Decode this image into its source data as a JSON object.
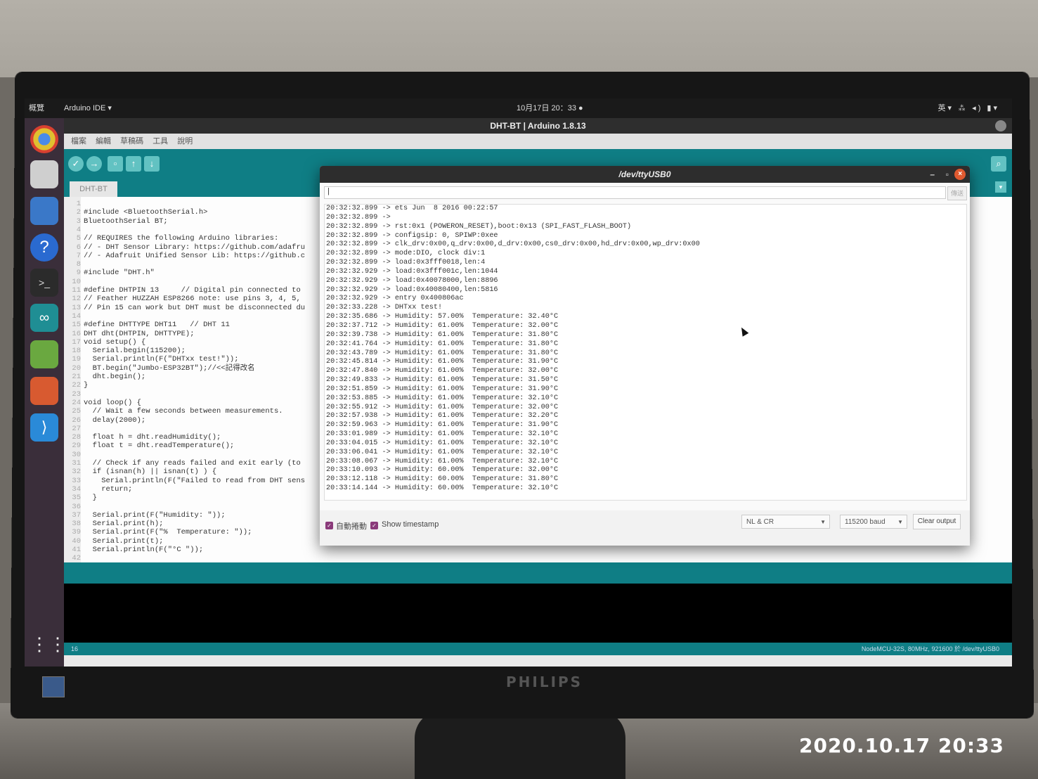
{
  "topbar": {
    "activities": "概覽",
    "app_menu": "Arduino IDE ▾",
    "clock": "10月17日 20：33 ●",
    "status": "英▾ ⁂ ◂) ▮▾"
  },
  "window": {
    "title": "DHT-BT | Arduino 1.8.13"
  },
  "menus": [
    "檔案",
    "編輯",
    "草稿碼",
    "工具",
    "說明"
  ],
  "tab": {
    "label": "DHT-BT"
  },
  "code": [
    {
      "n": "1",
      "t": ""
    },
    {
      "n": "2",
      "t": "#include <BluetoothSerial.h>"
    },
    {
      "n": "3",
      "t": "BluetoothSerial BT;"
    },
    {
      "n": "4",
      "t": ""
    },
    {
      "n": "5",
      "t": "// REQUIRES the following Arduino libraries:"
    },
    {
      "n": "6",
      "t": "// - DHT Sensor Library: https://github.com/adafru"
    },
    {
      "n": "7",
      "t": "// - Adafruit Unified Sensor Lib: https://github.c"
    },
    {
      "n": "8",
      "t": ""
    },
    {
      "n": "9",
      "t": "#include \"DHT.h\""
    },
    {
      "n": "10",
      "t": ""
    },
    {
      "n": "11",
      "t": "#define DHTPIN 13     // Digital pin connected to"
    },
    {
      "n": "12",
      "t": "// Feather HUZZAH ESP8266 note: use pins 3, 4, 5,"
    },
    {
      "n": "13",
      "t": "// Pin 15 can work but DHT must be disconnected du"
    },
    {
      "n": "14",
      "t": ""
    },
    {
      "n": "15",
      "t": "#define DHTTYPE DHT11   // DHT 11"
    },
    {
      "n": "16",
      "t": "DHT dht(DHTPIN, DHTTYPE);"
    },
    {
      "n": "17",
      "t": "void setup() {"
    },
    {
      "n": "18",
      "t": "  Serial.begin(115200);"
    },
    {
      "n": "19",
      "t": "  Serial.println(F(\"DHTxx test!\"));"
    },
    {
      "n": "20",
      "t": "  BT.begin(\"Jumbo-ESP32BT\");//<<記得改名"
    },
    {
      "n": "21",
      "t": "  dht.begin();"
    },
    {
      "n": "22",
      "t": "}"
    },
    {
      "n": "23",
      "t": ""
    },
    {
      "n": "24",
      "t": "void loop() {"
    },
    {
      "n": "25",
      "t": "  // Wait a few seconds between measurements."
    },
    {
      "n": "26",
      "t": "  delay(2000);"
    },
    {
      "n": "27",
      "t": ""
    },
    {
      "n": "28",
      "t": "  float h = dht.readHumidity();"
    },
    {
      "n": "29",
      "t": "  float t = dht.readTemperature();"
    },
    {
      "n": "30",
      "t": ""
    },
    {
      "n": "31",
      "t": "  // Check if any reads failed and exit early (to"
    },
    {
      "n": "32",
      "t": "  if (isnan(h) || isnan(t) ) {"
    },
    {
      "n": "33",
      "t": "    Serial.println(F(\"Failed to read from DHT sens"
    },
    {
      "n": "34",
      "t": "    return;"
    },
    {
      "n": "35",
      "t": "  }"
    },
    {
      "n": "36",
      "t": ""
    },
    {
      "n": "37",
      "t": "  Serial.print(F(\"Humidity: \"));"
    },
    {
      "n": "38",
      "t": "  Serial.print(h);"
    },
    {
      "n": "39",
      "t": "  Serial.print(F(\"%  Temperature: \"));"
    },
    {
      "n": "40",
      "t": "  Serial.print(t);"
    },
    {
      "n": "41",
      "t": "  Serial.println(F(\"°C \"));"
    },
    {
      "n": "42",
      "t": ""
    }
  ],
  "serial_monitor": {
    "title": "/dev/ttyUSB0",
    "input_value": "|",
    "send_label": "傳送",
    "output": [
      "20:32:32.899 -> ets Jun  8 2016 00:22:57",
      "20:32:32.899 ->",
      "20:32:32.899 -> rst:0x1 (POWERON_RESET),boot:0x13 (SPI_FAST_FLASH_BOOT)",
      "20:32:32.899 -> configsip: 0, SPIWP:0xee",
      "20:32:32.899 -> clk_drv:0x00,q_drv:0x00,d_drv:0x00,cs0_drv:0x00,hd_drv:0x00,wp_drv:0x00",
      "20:32:32.899 -> mode:DIO, clock div:1",
      "20:32:32.899 -> load:0x3fff0018,len:4",
      "20:32:32.929 -> load:0x3fff001c,len:1044",
      "20:32:32.929 -> load:0x40078000,len:8896",
      "20:32:32.929 -> load:0x40080400,len:5816",
      "20:32:32.929 -> entry 0x400806ac",
      "20:32:33.228 -> DHTxx test!",
      "20:32:35.686 -> Humidity: 57.00%  Temperature: 32.40°C",
      "20:32:37.712 -> Humidity: 61.00%  Temperature: 32.00°C",
      "20:32:39.738 -> Humidity: 61.00%  Temperature: 31.80°C",
      "20:32:41.764 -> Humidity: 61.00%  Temperature: 31.80°C",
      "20:32:43.789 -> Humidity: 61.00%  Temperature: 31.80°C",
      "20:32:45.814 -> Humidity: 61.00%  Temperature: 31.90°C",
      "20:32:47.840 -> Humidity: 61.00%  Temperature: 32.00°C",
      "20:32:49.833 -> Humidity: 61.00%  Temperature: 31.50°C",
      "20:32:51.859 -> Humidity: 61.00%  Temperature: 31.90°C",
      "20:32:53.885 -> Humidity: 61.00%  Temperature: 32.10°C",
      "20:32:55.912 -> Humidity: 61.00%  Temperature: 32.00°C",
      "20:32:57.938 -> Humidity: 61.00%  Temperature: 32.20°C",
      "20:32:59.963 -> Humidity: 61.00%  Temperature: 31.90°C",
      "20:33:01.989 -> Humidity: 61.00%  Temperature: 32.10°C",
      "20:33:04.015 -> Humidity: 61.00%  Temperature: 32.10°C",
      "20:33:06.041 -> Humidity: 61.00%  Temperature: 32.10°C",
      "20:33:08.067 -> Humidity: 61.00%  Temperature: 32.10°C",
      "20:33:10.093 -> Humidity: 60.00%  Temperature: 32.00°C",
      "20:33:12.118 -> Humidity: 60.00%  Temperature: 31.80°C",
      "20:33:14.144 -> Humidity: 60.00%  Temperature: 32.10°C"
    ],
    "autoscroll_label": "自動捲動",
    "timestamp_label": "Show timestamp",
    "line_ending": "NL & CR",
    "baud": "115200 baud",
    "clear_label": "Clear output"
  },
  "status_bar": {
    "line": "16",
    "board": "NodeMCU-32S, 80MHz, 921600 於 /dev/ttyUSB0"
  },
  "monitor_brand": "PHILIPS",
  "photo_timestamp": "2020.10.17 20:33"
}
